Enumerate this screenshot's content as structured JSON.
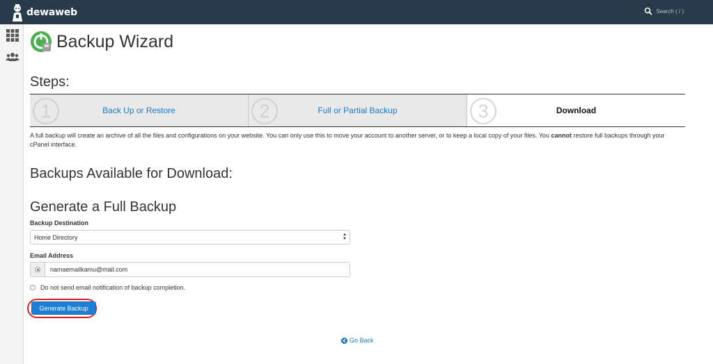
{
  "header": {
    "logo_text": "dewaweb",
    "search_placeholder": "Search ( / )"
  },
  "sidebar": {
    "items": [
      {
        "icon": "grid-icon",
        "label": ""
      },
      {
        "icon": "users-icon",
        "label": ""
      }
    ]
  },
  "page": {
    "title": "Backup Wizard",
    "steps_heading": "Steps:",
    "steps": [
      {
        "number": "1",
        "label": "Back Up or Restore",
        "active": false
      },
      {
        "number": "2",
        "label": "Full or Partial Backup",
        "active": false
      },
      {
        "number": "3",
        "label": "Download",
        "active": true
      }
    ],
    "description_part1": "A full backup will create an archive of all the files and configurations on your website. You can only use this to move your account to another server, or to keep a local copy of your files. You ",
    "description_bold": "cannot",
    "description_part2": " restore full backups through your cPanel interface.",
    "available_heading": "Backups Available for Download:",
    "generate_heading": "Generate a Full Backup"
  },
  "form": {
    "destination_label": "Backup Destination",
    "destination_value": "Home Directory",
    "email_label": "Email Address",
    "email_value": "namaemailkamu@mail.com",
    "no_email_label": "Do not send email notification of backup completion.",
    "generate_button": "Generate Backup",
    "go_back": "Go Back"
  },
  "colors": {
    "topbar": "#293a4a",
    "link": "#1a7bc4",
    "button": "#1c7ed6",
    "highlight": "#e01e1e"
  }
}
